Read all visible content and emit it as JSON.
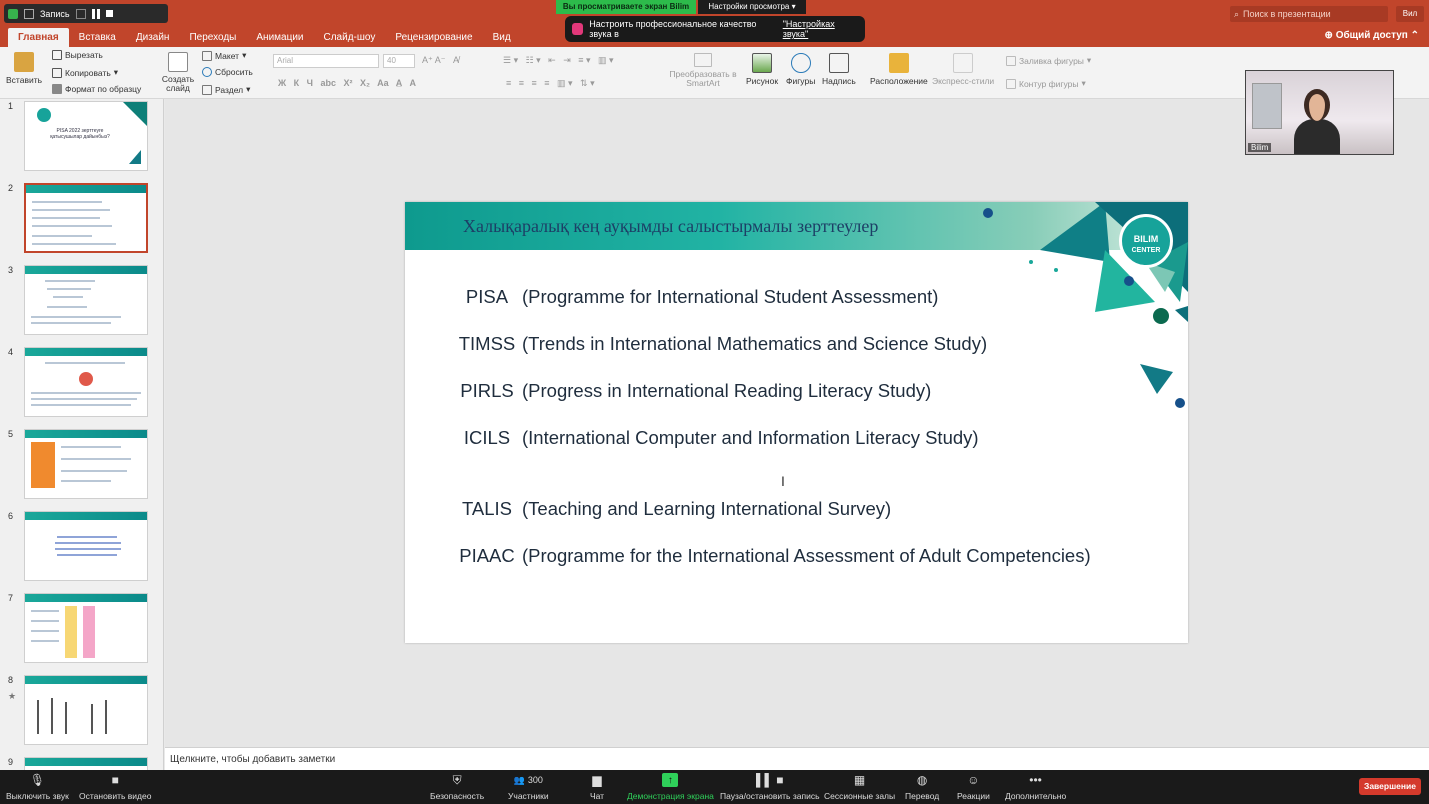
{
  "zoom_top": {
    "recording_label": "Запись",
    "share_banner": "Вы просматриваете экран Bilim",
    "view_settings": "Настройки просмотра",
    "audio_tip_text": "Настроить профессиональное качество звука в",
    "audio_tip_link": "\"Настройках звука\""
  },
  "ppt": {
    "search_placeholder": "Поиск в презентации",
    "user_short": "Вил",
    "tabs": [
      "Главная",
      "Вставка",
      "Дизайн",
      "Переходы",
      "Анимации",
      "Слайд-шоу",
      "Рецензирование",
      "Вид"
    ],
    "share_label": "Общий доступ",
    "ribbon": {
      "paste": "Вставить",
      "cut": "Вырезать",
      "copy": "Копировать",
      "format_painter": "Формат по образцу",
      "new_slide": "Создать слайд",
      "layout": "Макет",
      "reset": "Сбросить",
      "section": "Раздел",
      "font_name": "Arial",
      "font_size": "40",
      "convert_smartart": "Преобразовать в SmartArt",
      "picture": "Рисунок",
      "shapes": "Фигуры",
      "textbox": "Надпись",
      "arrange": "Расположение",
      "quick_styles": "Экспресс-стили",
      "shape_fill": "Заливка фигуры",
      "shape_outline": "Контур фигуры"
    },
    "slide_numbers": [
      "1",
      "2",
      "3",
      "4",
      "5",
      "6",
      "7",
      "8",
      "9"
    ],
    "thumb1_text": "PISA 2022 зерттеуге қатысушылар дайынбыз?",
    "slide": {
      "title": "Халықаралық кең ауқымды салыстырмалы зерттеулер",
      "logo_top": "BILIM",
      "logo_bottom": "CENTER",
      "studies": [
        {
          "abbr": "PISA",
          "full": "(Programme for International Student Assessment)"
        },
        {
          "abbr": "TIMSS",
          "full": "(Trends in International Mathematics and Science Study)"
        },
        {
          "abbr": "PIRLS",
          "full": "(Progress in International Reading Literacy Study)"
        },
        {
          "abbr": "ICILS",
          "full": "(International Computer and Information Literacy Study)"
        },
        {
          "abbr": "TALIS",
          "full": "(Teaching and Learning International Survey)"
        },
        {
          "abbr": "PIAAC",
          "full": "(Programme for the International Assessment of Adult Competencies)"
        }
      ]
    },
    "notes_placeholder": "Щелкните, чтобы добавить заметки"
  },
  "webcam": {
    "name": "Bilim"
  },
  "zoom_bottom": {
    "mute": "Выключить звук",
    "video": "Остановить видео",
    "security": "Безопасность",
    "participants": "Участники",
    "participants_count": "300",
    "chat": "Чат",
    "share": "Демонстрация экрана",
    "pause_share": "Пауза/остановить запись",
    "rooms": "Сессионные залы",
    "translate": "Перевод",
    "reactions": "Реакции",
    "more": "Дополнительно",
    "end": "Завершение"
  },
  "colors": {
    "ppt_accent": "#c1452b",
    "slide_teal": "#17a39a",
    "zoom_green": "#2dbb4b",
    "end_red": "#d43a2c"
  }
}
